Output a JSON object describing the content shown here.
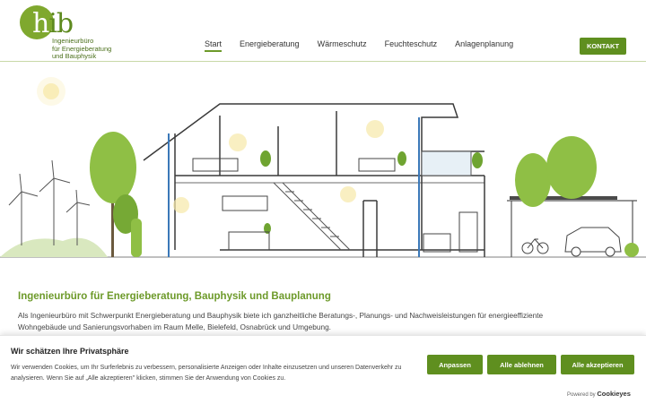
{
  "logo": {
    "letters_h": "h",
    "letters_ib": "ib",
    "subtitle": "Ingenieurbüro\nfür Energieberatung\nund Bauphysik"
  },
  "nav": {
    "items": [
      {
        "label": "Start",
        "active": true
      },
      {
        "label": "Energieberatung",
        "active": false
      },
      {
        "label": "Wärmeschutz",
        "active": false
      },
      {
        "label": "Feuchteschutz",
        "active": false
      },
      {
        "label": "Anlagenplanung",
        "active": false
      }
    ],
    "contact_label": "KONTAKT"
  },
  "content": {
    "title": "Ingenieurbüro für Energieberatung, Bauphysik und Bauplanung",
    "text": "Als Ingenieurbüro mit Schwerpunkt Energieberatung und Bauphysik biete ich ganzheitliche Beratungs-, Planungs- und Nachweisleistungen für energieeffiziente Wohngebäude und Sanierungsvorhaben im Raum Melle, Bielefeld, Osnabrück und Umgebung."
  },
  "cookie": {
    "title": "Wir schätzen Ihre Privatsphäre",
    "text": "Wir verwenden Cookies, um Ihr Surferlebnis zu verbessern, personalisierte Anzeigen oder Inhalte einzusetzen und unseren Datenverkehr zu analysieren. Wenn Sie auf „Alle akzeptieren\" klicken, stimmen Sie der Anwendung von Cookies zu.",
    "customize_label": "Anpassen",
    "reject_label": "Alle ablehnen",
    "accept_label": "Alle akzeptieren",
    "powered_by": "Powered by",
    "brand": "Cookieyes"
  },
  "colors": {
    "brand_green": "#5f8f1f",
    "accent_green": "#7fa82e"
  }
}
